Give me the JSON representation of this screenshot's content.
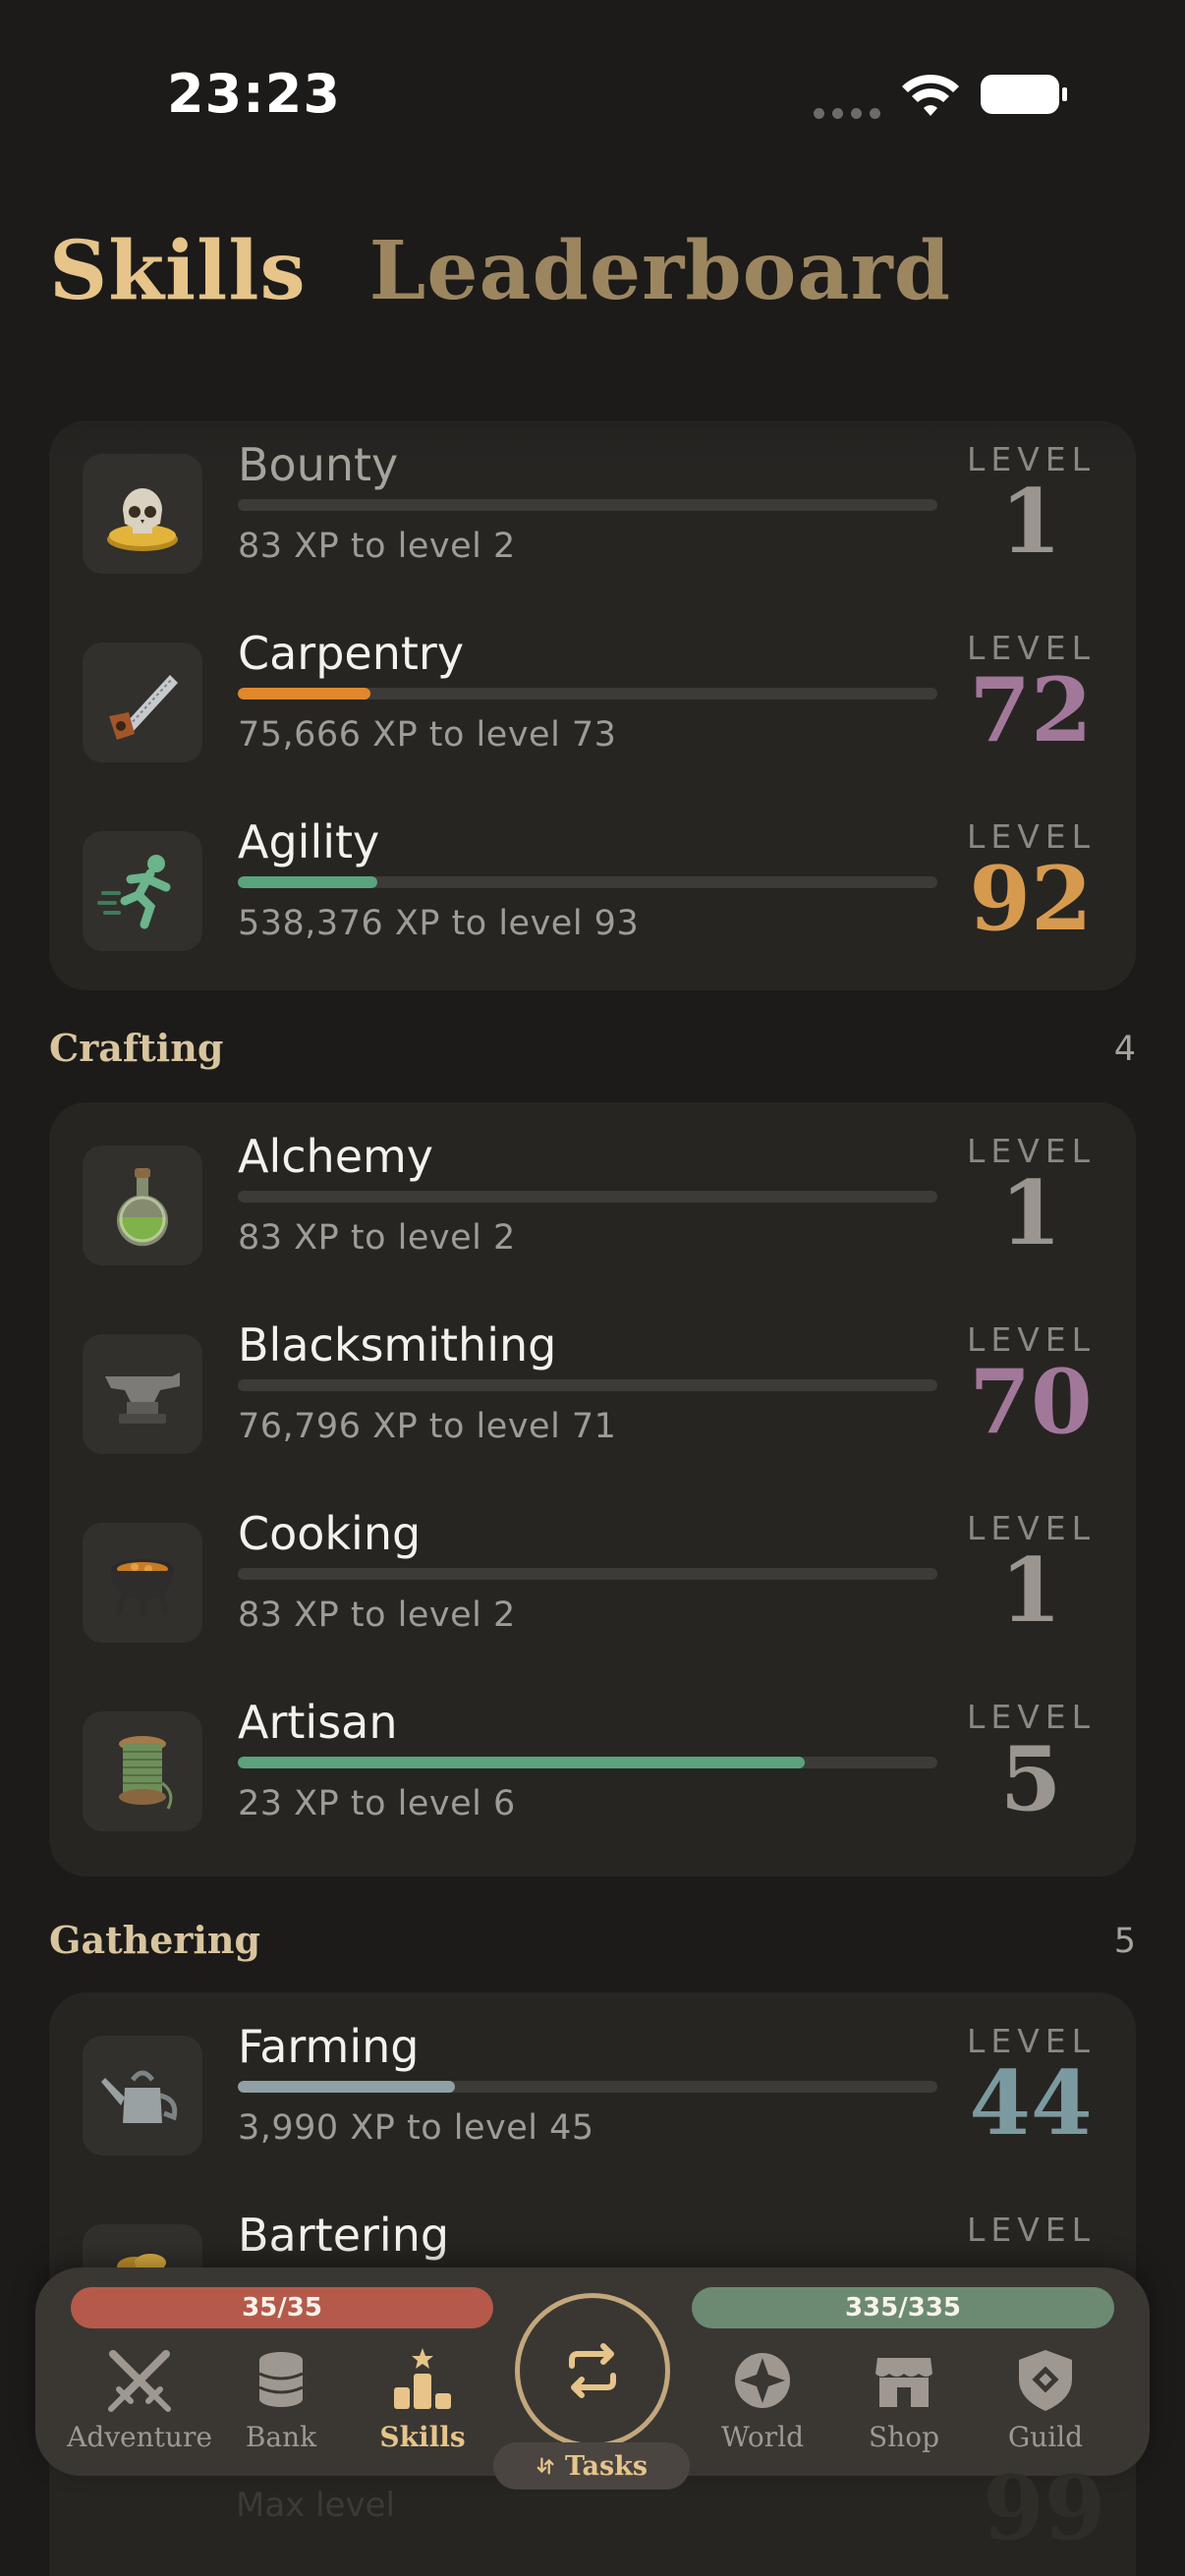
{
  "status": {
    "time": "23:23"
  },
  "tabs": [
    {
      "label": "Skills",
      "active": true
    },
    {
      "label": "Leaderboard",
      "active": false
    }
  ],
  "level_label": "LEVEL",
  "groups": {
    "first": {
      "skills": [
        {
          "name": "Bounty",
          "xp_text": "83 XP to level 2",
          "level": "1",
          "progress": 0,
          "bar_color": "#6f6c67",
          "level_color": "#9a968f",
          "icon": "skull-icon"
        },
        {
          "name": "Carpentry",
          "xp_text": "75,666 XP to level 73",
          "level": "72",
          "progress": 0.19,
          "bar_color": "#e0882c",
          "level_color": "#a2789a",
          "icon": "saw-icon"
        },
        {
          "name": "Agility",
          "xp_text": "538,376 XP to level 93",
          "level": "92",
          "progress": 0.2,
          "bar_color": "#5aa37e",
          "level_color": "#d69a4f",
          "icon": "runner-icon"
        }
      ]
    },
    "crafting": {
      "title": "Crafting",
      "count": "4",
      "skills": [
        {
          "name": "Alchemy",
          "xp_text": "83 XP to level 2",
          "level": "1",
          "progress": 0,
          "bar_color": "#6f6c67",
          "level_color": "#9a968f",
          "icon": "potion-icon"
        },
        {
          "name": "Blacksmithing",
          "xp_text": "76,796 XP to level 71",
          "level": "70",
          "progress": 0,
          "bar_color": "#6f6c67",
          "level_color": "#a2789a",
          "icon": "anvil-icon"
        },
        {
          "name": "Cooking",
          "xp_text": "83 XP to level 2",
          "level": "1",
          "progress": 0,
          "bar_color": "#6f6c67",
          "level_color": "#9a968f",
          "icon": "cauldron-icon"
        },
        {
          "name": "Artisan",
          "xp_text": "23 XP to level 6",
          "level": "5",
          "progress": 0.81,
          "bar_color": "#5aa37e",
          "level_color": "#9a968f",
          "icon": "spool-icon"
        }
      ]
    },
    "gathering": {
      "title": "Gathering",
      "count": "5",
      "skills": [
        {
          "name": "Farming",
          "xp_text": "3,990 XP to level 45",
          "level": "44",
          "progress": 0.31,
          "bar_color": "#8fa1a6",
          "level_color": "#7b9aa0",
          "icon": "watering-can-icon"
        },
        {
          "name": "Bartering",
          "xp_text": "",
          "level": "",
          "progress": 0,
          "bar_color": "#6f6c67",
          "level_color": "#9a968f",
          "icon": "coins-icon"
        }
      ]
    }
  },
  "bottom_nav": {
    "hp": "35/35",
    "energy": "335/335",
    "items": [
      {
        "label": "Adventure",
        "icon": "crossed-swords-icon",
        "active": false
      },
      {
        "label": "Bank",
        "icon": "coin-stack-icon",
        "active": false
      },
      {
        "label": "Skills",
        "icon": "podium-icon",
        "active": true
      },
      {
        "label": "World",
        "icon": "compass-icon",
        "active": false
      },
      {
        "label": "Shop",
        "icon": "shop-icon",
        "active": false
      },
      {
        "label": "Guild",
        "icon": "shield-icon",
        "active": false
      }
    ],
    "tasks_label": "Tasks"
  },
  "peek": {
    "text": "Max level",
    "level": "99"
  }
}
